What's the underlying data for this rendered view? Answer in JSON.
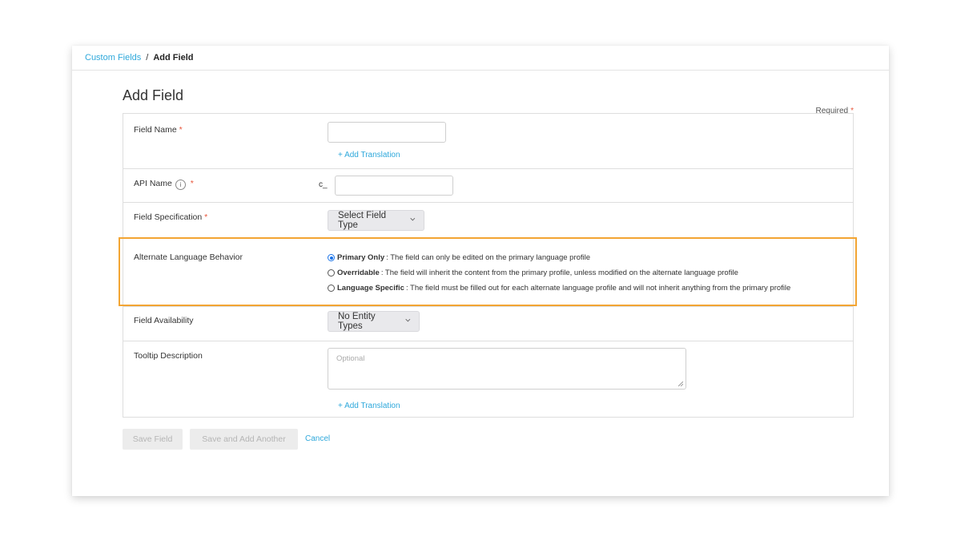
{
  "breadcrumb": {
    "parent": "Custom Fields",
    "separator": "/",
    "current": "Add Field"
  },
  "page_title": "Add Field",
  "required_note": "Required",
  "required_marker": "*",
  "form": {
    "field_name": {
      "label": "Field Name",
      "value": "",
      "add_translation": "+ Add Translation"
    },
    "api_name": {
      "label": "API Name",
      "info_icon": "i",
      "prefix": "c_",
      "value": ""
    },
    "field_specification": {
      "label": "Field Specification",
      "select_label": "Select Field Type"
    },
    "alternate_language": {
      "label": "Alternate Language Behavior",
      "options": [
        {
          "title": "Primary Only",
          "description": ": The field can only be edited on the primary language profile",
          "checked": true
        },
        {
          "title": "Overridable",
          "description": ": The field will inherit the content from the primary profile, unless modified on the alternate language profile",
          "checked": false
        },
        {
          "title": "Language Specific",
          "description": ": The field must be filled out for each alternate language profile and will not inherit anything from the primary profile",
          "checked": false
        }
      ]
    },
    "field_availability": {
      "label": "Field Availability",
      "select_label": "No Entity Types"
    },
    "tooltip_description": {
      "label": "Tooltip Description",
      "placeholder": "Optional",
      "add_translation": "+ Add Translation"
    }
  },
  "actions": {
    "save": "Save Field",
    "save_another": "Save and Add Another",
    "cancel": "Cancel"
  },
  "colors": {
    "accent_link": "#2ea8db",
    "required_star": "#e8553a",
    "highlight_border": "#f3a533",
    "radio_selected": "#1a73e8"
  }
}
